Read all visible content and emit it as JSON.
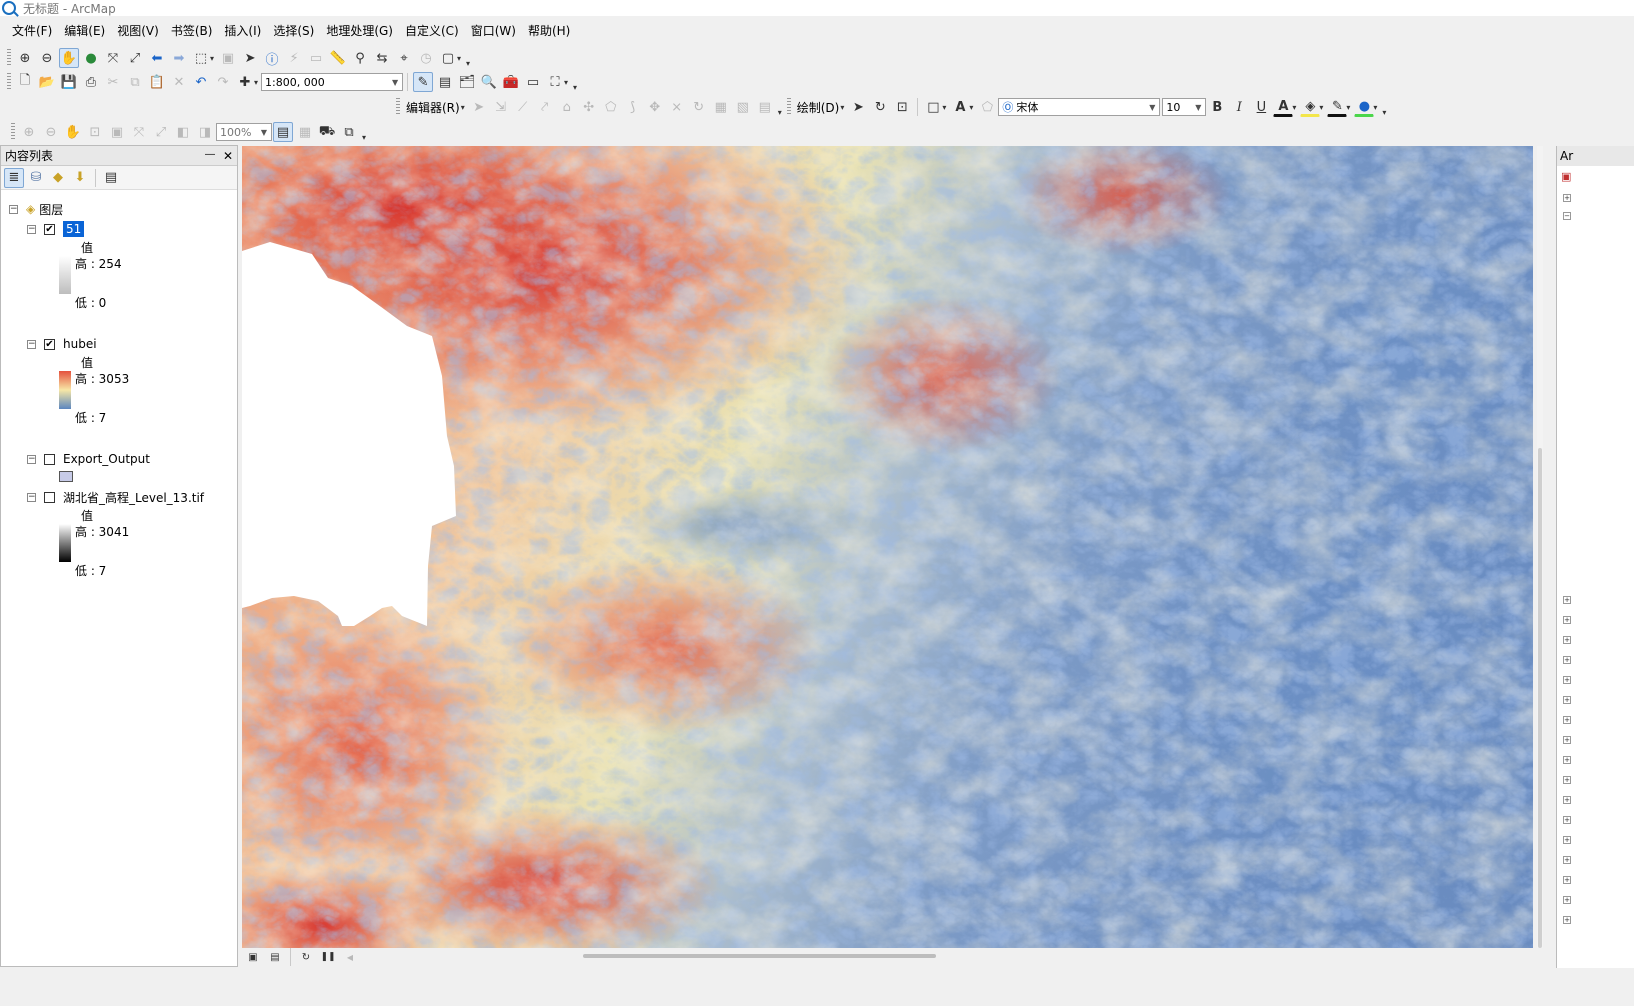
{
  "window": {
    "title": "无标题 - ArcMap"
  },
  "menu": [
    "文件(F)",
    "编辑(E)",
    "视图(V)",
    "书签(B)",
    "插入(I)",
    "选择(S)",
    "地理处理(G)",
    "自定义(C)",
    "窗口(W)",
    "帮助(H)"
  ],
  "toolbar": {
    "scale": "1:800, 000",
    "editor_label": "编辑器(R)",
    "draw_label": "绘制(D)",
    "font_name": "宋体",
    "font_size": "10",
    "bold": "B",
    "italic": "I",
    "underline": "U",
    "layout_zoom": "100%"
  },
  "toc": {
    "title": "内容列表",
    "pin": "―",
    "close": "✕",
    "root_label": "图层",
    "layers": [
      {
        "name": "51",
        "checked": true,
        "field": "值",
        "high": "高 : 254",
        "low": "低 : 0"
      },
      {
        "name": "hubei",
        "checked": true,
        "field": "值",
        "high": "高 : 3053",
        "low": "低 : 7"
      },
      {
        "name": "Export_Output",
        "checked": false
      },
      {
        "name": "湖北省_高程_Level_13.tif",
        "checked": false,
        "field": "值",
        "high": "高 : 3041",
        "low": "低 : 7"
      }
    ]
  },
  "right_panel": {
    "title": "Ar"
  },
  "colors": {
    "ramp_high": "#d7191c",
    "ramp_mid": "#fffebf",
    "ramp_low": "#2b83ba",
    "selection": "#0a64d6"
  }
}
